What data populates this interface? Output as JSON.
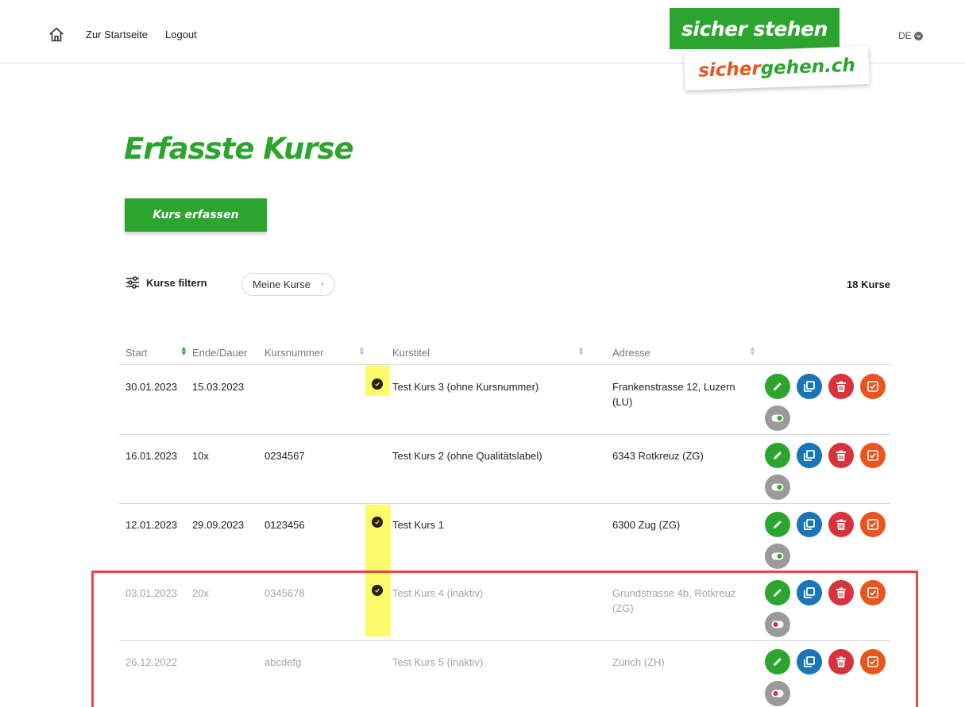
{
  "nav": {
    "home_label": "Zur Startseite",
    "logout_label": "Logout",
    "language": "DE"
  },
  "logo": {
    "line1": "sicher stehen",
    "line2_part1": "sicher",
    "line2_part2": "gehen.ch"
  },
  "page": {
    "title": "Erfasste Kurse",
    "create_button": "Kurs erfassen"
  },
  "filter": {
    "toggle_label": "Kurse filtern",
    "active_chip": "Meine Kurse",
    "chip_remove": "×",
    "result_count": "18 Kurse"
  },
  "table": {
    "headers": {
      "start": "Start",
      "end": "Ende/Dauer",
      "number": "Kursnummer",
      "title": "Kurstitel",
      "address": "Adresse"
    },
    "rows": [
      {
        "start": "30.01.2023",
        "end": "15.03.2023",
        "number": "",
        "quality": true,
        "title": "Test Kurs 3 (ohne Kursnummer)",
        "address": "Frankenstrasse 12, Luzern (LU)",
        "active": true
      },
      {
        "start": "16.01.2023",
        "end": "10x",
        "number": "0234567",
        "quality": false,
        "title": "Test Kurs 2 (ohne Qualitätslabel)",
        "address": "6343 Rotkreuz (ZG)",
        "active": true
      },
      {
        "start": "12.01.2023",
        "end": "29.09.2023",
        "number": "0123456",
        "quality": true,
        "title": "Test Kurs 1",
        "address": "6300 Zug (ZG)",
        "active": true
      },
      {
        "start": "03.01.2023",
        "end": "20x",
        "number": "0345678",
        "quality": true,
        "title": "Test Kurs 4 (inaktiv)",
        "address": "Grundstrasse 4b, Rotkreuz (ZG)",
        "active": false
      },
      {
        "start": "26.12.2022",
        "end": "",
        "number": "abcdefg",
        "quality": false,
        "title": "Test Kurs 5 (inaktiv)",
        "address": "Zürich (ZH)",
        "active": false
      }
    ]
  },
  "icons": {
    "home": "home-icon",
    "filter": "sliders-icon",
    "edit": "pencil-icon",
    "copy": "copy-icon",
    "delete": "trash-icon",
    "check": "checkbox-icon",
    "toggle": "toggle-icon",
    "quality": "check-circle-icon"
  },
  "colors": {
    "brand_green": "#2ca52f",
    "brand_orange": "#e8561d",
    "copy_blue": "#1a74b8",
    "delete_red": "#d8323d",
    "toggle_grey": "#9a9a9a",
    "toggle_on": "#2ca52f",
    "toggle_off": "#d8323d",
    "highlight_yellow": "#fffa6b",
    "highlight_red": "#e8474c"
  }
}
